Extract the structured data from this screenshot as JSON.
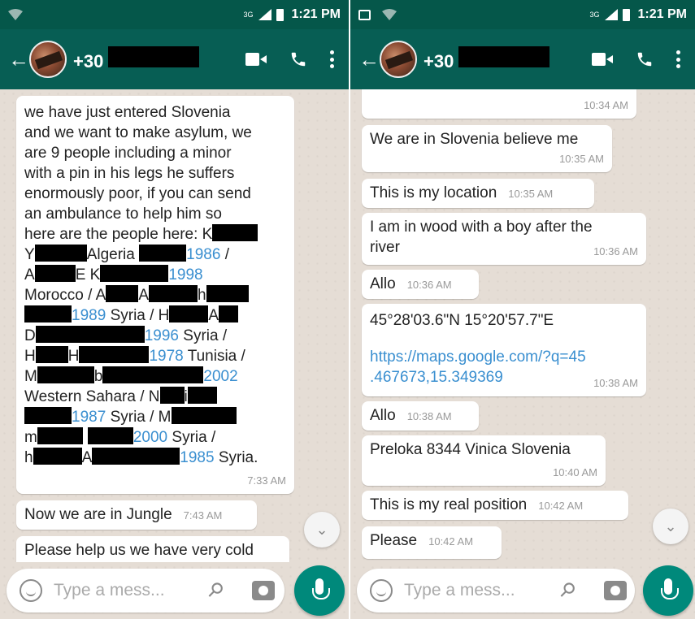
{
  "left": {
    "status": {
      "network": "3G",
      "time": "1:21 PM"
    },
    "header": {
      "phone_prefix": "+30"
    },
    "messages": {
      "long_msg": {
        "line1": "we have just entered Slovenia",
        "line2": "and we want to make asylum, we",
        "line3": "are 9 people including a minor",
        "line4": "with a pin in his legs he suffers",
        "line5": "enormously poor, if you can send",
        "line6": "an ambulance to help him so",
        "line7": "here are the people here: K",
        "l8a": "Y",
        "l8b": "Algeria",
        "l8c": "1986",
        "l8d": "/",
        "l9a": "A",
        "l9b": "E K",
        "l9c": "1998",
        "l10a": "Morocco / A",
        "l10b": "A",
        "l10c": "h",
        "l11a": "1989",
        "l11b": "Syria / H",
        "l11c": "A",
        "l12a": "D",
        "l12b": "1996",
        "l12c": "Syria /",
        "l13a": "H",
        "l13b": "H",
        "l13c": "1978",
        "l13d": "Tunisia /",
        "l14a": "M",
        "l14b": "b",
        "l14c": "2002",
        "l15a": "Western Sahara / N",
        "l15b": "i",
        "l16a": "1987",
        "l16b": "Syria / M",
        "l17a": "m",
        "l17b": "2000",
        "l17c": "Syria /",
        "l18a": "h",
        "l18b": "A",
        "l18c": "1985",
        "l18d": "Syria.",
        "time": "7:33 AM"
      },
      "m2": {
        "text": "Now we are in Jungle",
        "time": "7:43 AM"
      },
      "m3": {
        "text": "Please help us we have very cold"
      }
    },
    "input": {
      "placeholder": "Type a mess..."
    }
  },
  "right": {
    "status": {
      "network": "3G",
      "time": "1:21 PM"
    },
    "header": {
      "phone_prefix": "+30"
    },
    "messages": {
      "m0": {
        "time": "10:34 AM"
      },
      "m1": {
        "text": "We are in Slovenia believe me",
        "time": "10:35 AM"
      },
      "m2": {
        "text": "This is my location",
        "time": "10:35 AM"
      },
      "m3": {
        "line1": "I am in wood with a boy after the",
        "line2": "river",
        "time": "10:36 AM"
      },
      "m4": {
        "text": "Allo",
        "time": "10:36 AM"
      },
      "m5": {
        "coords": "45°28'03.6\"N 15°20'57.7\"E",
        "link1": "https://maps.google.com/?q=45",
        "link2": ".467673,15.349369",
        "time": "10:38 AM"
      },
      "m6": {
        "text": "Allo",
        "time": "10:38 AM"
      },
      "m7": {
        "text": "Preloka 8344 Vinica Slovenia",
        "time": "10:40 AM"
      },
      "m8": {
        "text": "This is my real position",
        "time": "10:42 AM"
      },
      "m9": {
        "text": "Please",
        "time": "10:42 AM"
      }
    },
    "input": {
      "placeholder": "Type a mess..."
    }
  }
}
